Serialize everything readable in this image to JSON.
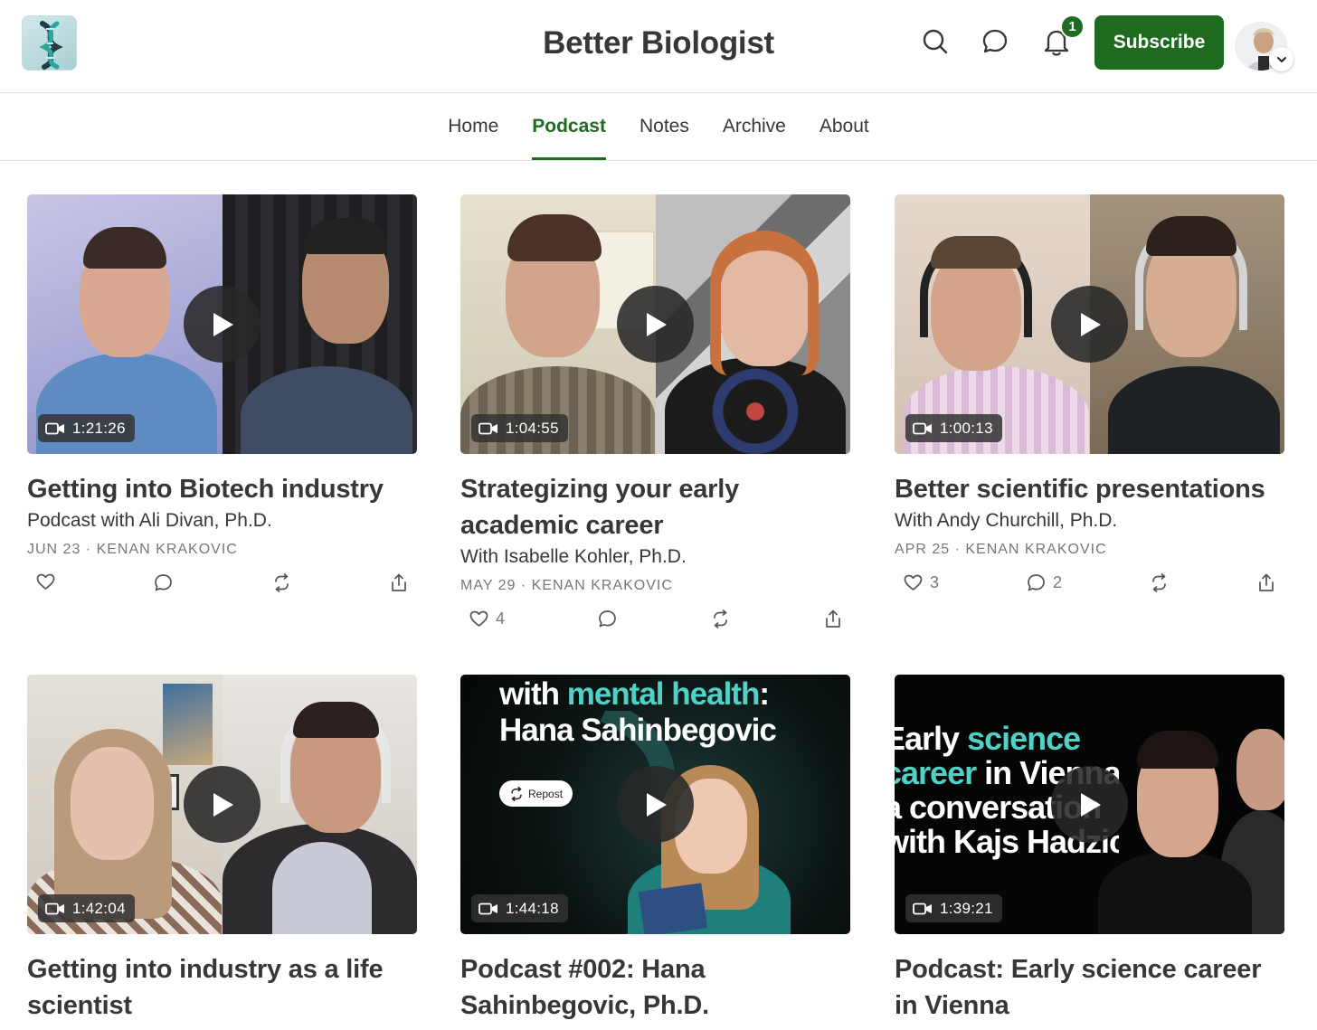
{
  "header": {
    "site_title": "Better Biologist",
    "notification_count": "1",
    "subscribe_label": "Subscribe",
    "icons": [
      "search-icon",
      "chat-icon",
      "bell-icon",
      "chevron-down-icon"
    ]
  },
  "nav": {
    "tabs": [
      {
        "label": "Home",
        "active": false
      },
      {
        "label": "Podcast",
        "active": true
      },
      {
        "label": "Notes",
        "active": false
      },
      {
        "label": "Archive",
        "active": false
      },
      {
        "label": "About",
        "active": false
      }
    ]
  },
  "colors": {
    "brand_green": "#1e6a1e",
    "text": "#363737",
    "meta": "#777777"
  },
  "posts": [
    {
      "title": "Getting into Biotech industry",
      "subtitle": "Podcast with Ali Divan, Ph.D.",
      "date": "JUN 23",
      "author": "KENAN KRAKOVIC",
      "duration": "1:21:26",
      "likes": "",
      "comments": ""
    },
    {
      "title": "Strategizing your early academic career",
      "subtitle": "With Isabelle Kohler, Ph.D.",
      "date": "MAY 29",
      "author": "KENAN KRAKOVIC",
      "duration": "1:04:55",
      "likes": "4",
      "comments": ""
    },
    {
      "title": "Better scientific presentations",
      "subtitle": "With Andy Churchill, Ph.D.",
      "date": "APR 25",
      "author": "KENAN KRAKOVIC",
      "duration": "1:00:13",
      "likes": "3",
      "comments": "2"
    },
    {
      "title": "Getting into industry as a life scientist",
      "duration": "1:42:04"
    },
    {
      "title": "Podcast #002: Hana Sahinbegovic, Ph.D.",
      "duration": "1:44:18",
      "poster": {
        "line1a": "with ",
        "line1b": "mental health",
        "line1c": ":",
        "line2": "Hana Sahinbegovic",
        "repost_label": "Repost"
      }
    },
    {
      "title": "Podcast: Early science career in Vienna",
      "duration": "1:39:21",
      "poster": {
        "line1a": "Early ",
        "line1b": "science",
        "line2a": "career",
        "line2b": " in Vienna",
        "line3": "a conversation",
        "line4": "with Kajs Hadzic"
      }
    }
  ]
}
